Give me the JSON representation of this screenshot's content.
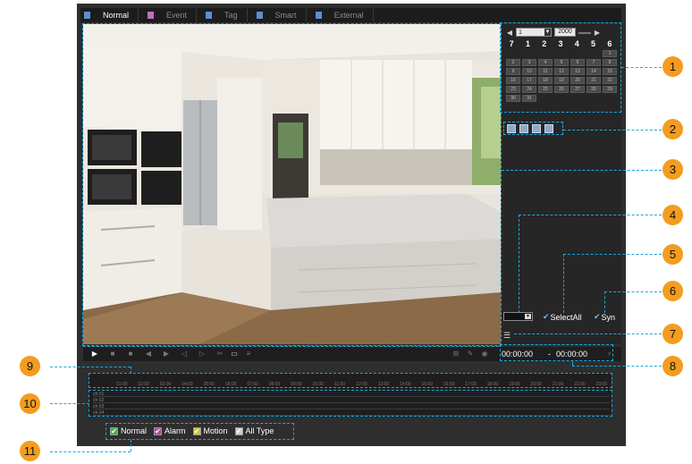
{
  "tabs": [
    {
      "label": "Normal",
      "active": true,
      "icon_color": "#5b8fd0"
    },
    {
      "label": "Event",
      "active": false,
      "icon_color": "#c070c0"
    },
    {
      "label": "Tag",
      "active": false,
      "icon_color": "#5b8fd0"
    },
    {
      "label": "Smart",
      "active": false,
      "icon_color": "#5b8fd0"
    },
    {
      "label": "External",
      "active": false,
      "icon_color": "#5b8fd0"
    }
  ],
  "calendar": {
    "prev_icon": "triangle-left-icon",
    "next_icon": "triangle-right-icon",
    "month_value": "1",
    "year_value": "2000",
    "weekdays": [
      "7",
      "1",
      "2",
      "3",
      "4",
      "5",
      "6"
    ],
    "days": [
      "",
      "",
      "",
      "",
      "",
      "",
      "1",
      "2",
      "3",
      "4",
      "5",
      "6",
      "7",
      "8",
      "9",
      "10",
      "11",
      "12",
      "13",
      "14",
      "15",
      "16",
      "17",
      "18",
      "19",
      "20",
      "21",
      "22",
      "23",
      "24",
      "25",
      "26",
      "27",
      "28",
      "29",
      "30",
      "31"
    ]
  },
  "split_buttons": 4,
  "select_all_label": "SelectAll",
  "syn_label": "Syn",
  "toolbar": {
    "start_time": "00:00:00",
    "separator": "-",
    "end_time": "00:00:00"
  },
  "timeline": {
    "hours": [
      "01:00",
      "02:00",
      "03:00",
      "04:00",
      "05:00",
      "06:00",
      "07:00",
      "08:00",
      "09:00",
      "10:00",
      "11:00",
      "12:00",
      "13:00",
      "14:00",
      "15:00",
      "16:00",
      "17:00",
      "18:00",
      "19:00",
      "20:00",
      "21:00",
      "22:00",
      "23:00"
    ],
    "channels": [
      "ch 01",
      "ch 02",
      "ch 03",
      "ch 04"
    ]
  },
  "legend": [
    {
      "label": "Normal",
      "color": "#4caf50"
    },
    {
      "label": "Alarm",
      "color": "#b04fa0"
    },
    {
      "label": "Motion",
      "color": "#d4c440"
    },
    {
      "label": "All Type",
      "color": "#cfcfcf"
    }
  ],
  "callouts": [
    "1",
    "2",
    "3",
    "4",
    "5",
    "6",
    "7",
    "8",
    "9",
    "10",
    "11"
  ],
  "colors": {
    "accent": "#f39c1f",
    "annotation": "#19a8e0",
    "panel": "#2e2e2e"
  }
}
